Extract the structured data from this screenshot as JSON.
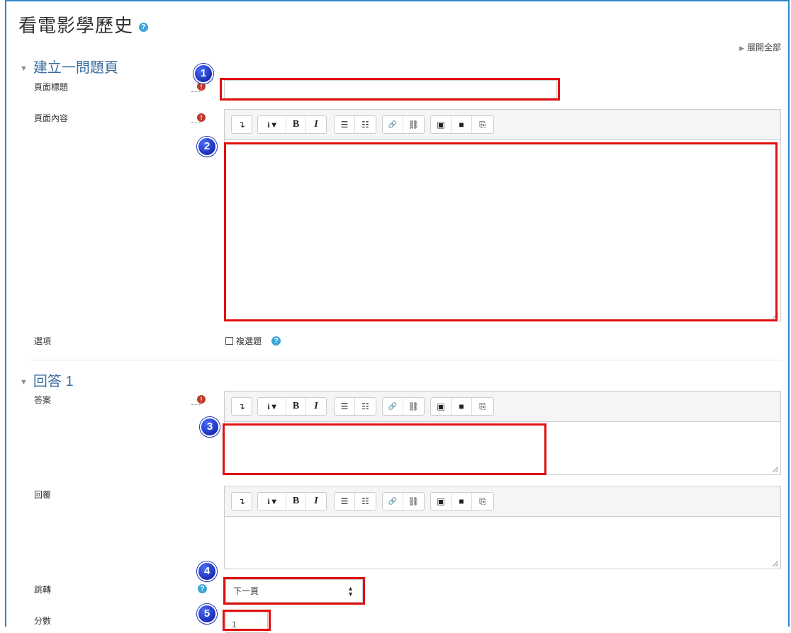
{
  "page": {
    "title": "看電影學歷史",
    "expand_all": "展開全部"
  },
  "section1": {
    "heading": "建立一問題頁",
    "page_title_label": "頁面標題",
    "page_title_value": "",
    "page_content_label": "頁面內容",
    "options_label": "選項",
    "multiple_choice_label": "複選題"
  },
  "section2": {
    "heading": "回答 1",
    "answer_label": "答案",
    "response_label": "回覆",
    "jump_label": "跳轉",
    "jump_value": "下一頁",
    "score_label": "分數",
    "score_value": "1"
  },
  "annotations": [
    "1",
    "2",
    "3",
    "4",
    "5"
  ],
  "icons": {
    "help": "?",
    "required": "!",
    "toolbar": [
      "collapse-icon",
      "info-dropdown-icon",
      "bold-icon",
      "italic-icon",
      "unordered-list-icon",
      "ordered-list-icon",
      "link-icon",
      "unlink-icon",
      "image-icon",
      "media-icon",
      "paste-icon"
    ],
    "toolbar_text": {
      "collapse": "↴",
      "info": "i ▾",
      "bold": "B",
      "italic": "I",
      "ul": "☰",
      "ol": "☷",
      "link": "🔗",
      "unlink": "⛓",
      "image": "▣",
      "media": "■",
      "paste": "⎘"
    }
  },
  "colors": {
    "accent": "#2b87c9",
    "annotation": "#e10f0f",
    "badge": "#1a2fb8"
  }
}
